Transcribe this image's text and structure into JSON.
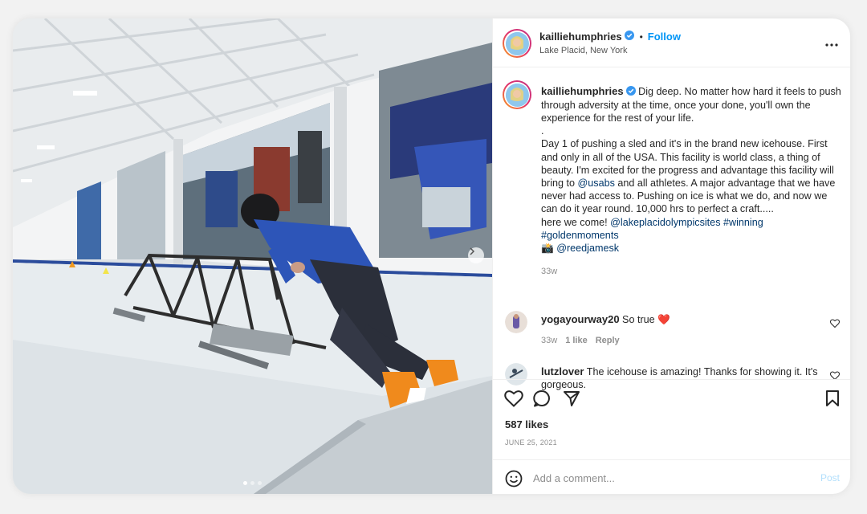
{
  "post": {
    "username": "kailliehumphries",
    "verified": true,
    "follow_label": "Follow",
    "dot_separator": "•",
    "location": "Lake Placid, New York",
    "more_icon": "more-horizontal-icon"
  },
  "caption": {
    "username": "kailliehumphries",
    "line1": "Dig deep. No matter how hard it feels to push through adversity at the time, once your done, you'll own the experience for the rest of your life.",
    "line2": ".",
    "line3_a": "Day 1 of pushing a sled and it's in the brand new icehouse. First and only in all of the USA. This facility is world class, a thing of beauty. I'm excited for the progress and advantage this facility will bring to ",
    "mention_usabs": "@usabs",
    "line3_b": " and all athletes. A major advantage that we have never had access to. Pushing on ice is what we do, and now we can do it year round. 10,000 hrs to perfect a craft.....",
    "line4_a": "here we come! ",
    "mention_lake": "@lakeplacidolympicsites",
    "hashtag_winning": "#winning",
    "hashtag_golden": "#goldenmoments",
    "camera_emoji": "📸",
    "mention_reed": "@reedjamesk",
    "time": "33w"
  },
  "comments": [
    {
      "username": "yogayourway20",
      "text": "So true",
      "emoji": "❤️",
      "time": "33w",
      "likes": "1 like",
      "reply": "Reply"
    },
    {
      "username": "lutzlover",
      "text": "The icehouse is amazing! Thanks for showing it. It's gorgeous."
    }
  ],
  "actions": {
    "likes": "587 likes",
    "date": "JUNE 25, 2021"
  },
  "add_comment": {
    "placeholder": "Add a comment...",
    "post_label": "Post"
  },
  "carousel": {
    "slide_count": 3,
    "active_index": 0
  },
  "colors": {
    "accent": "#0095f6",
    "verified": "#3897f0",
    "link": "#00376b",
    "heart": "#ed4956"
  }
}
